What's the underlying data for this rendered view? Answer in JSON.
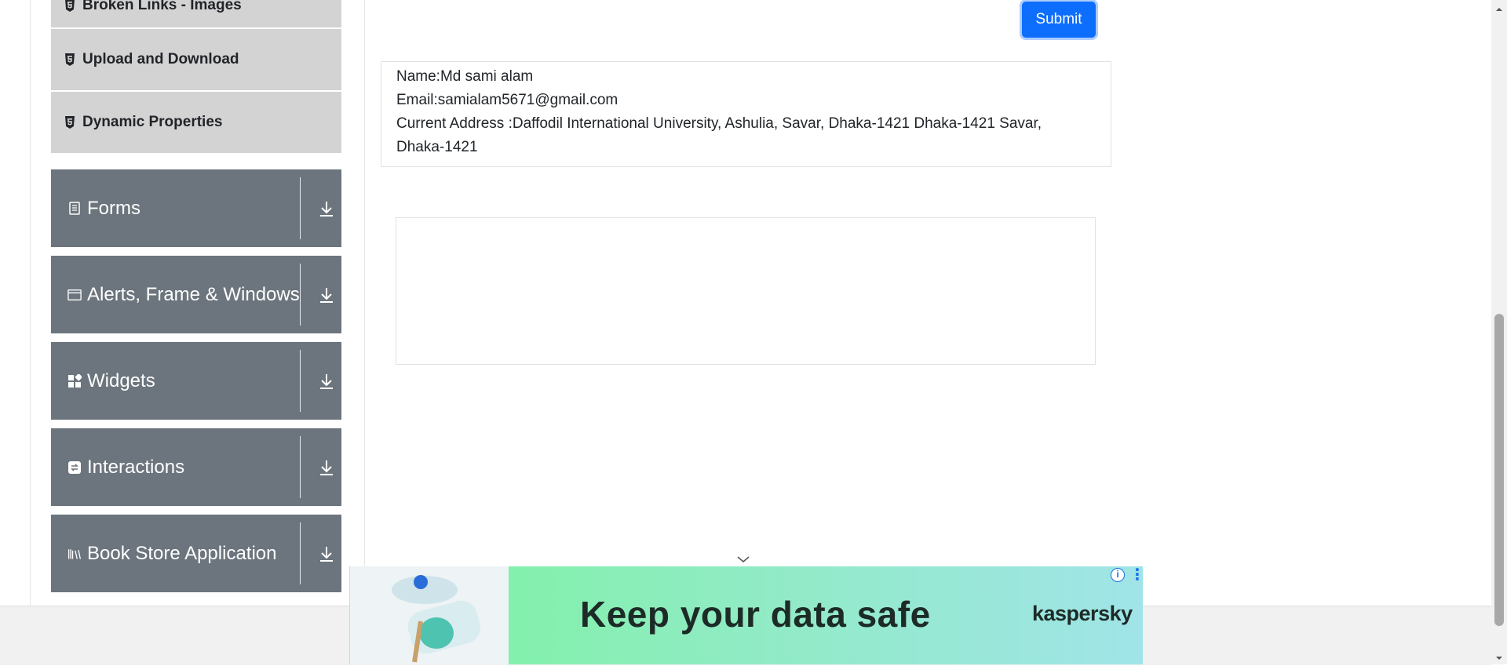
{
  "sidebar": {
    "subitems": [
      {
        "label": "Broken Links - Images",
        "icon": "html5-icon"
      },
      {
        "label": "Upload and Download",
        "icon": "html5-icon"
      },
      {
        "label": "Dynamic Properties",
        "icon": "html5-icon"
      }
    ],
    "groups": [
      {
        "label": "Forms",
        "icon": "form-icon"
      },
      {
        "label": "Alerts, Frame & Windows",
        "icon": "window-icon"
      },
      {
        "label": "Widgets",
        "icon": "widgets-icon"
      },
      {
        "label": "Interactions",
        "icon": "interactions-icon"
      },
      {
        "label": "Book Store Application",
        "icon": "library-icon"
      }
    ]
  },
  "form": {
    "submit_label": "Submit"
  },
  "output": {
    "name": "Name:Md sami alam",
    "email": "Email:samialam5671@gmail.com",
    "address": "Current Address :Daffodil International University, Ashulia, Savar, Dhaka-1421 Dhaka-1421 Savar, Dhaka-1421"
  },
  "ad": {
    "headline": "Keep your data safe",
    "brand": "kaspersky",
    "colors": {
      "start": "#7af39c",
      "end": "#a0e4e8"
    }
  },
  "colors": {
    "group_bg": "#6c757d",
    "subitem_bg": "#d3d3d3",
    "primary": "#0d6efd"
  }
}
